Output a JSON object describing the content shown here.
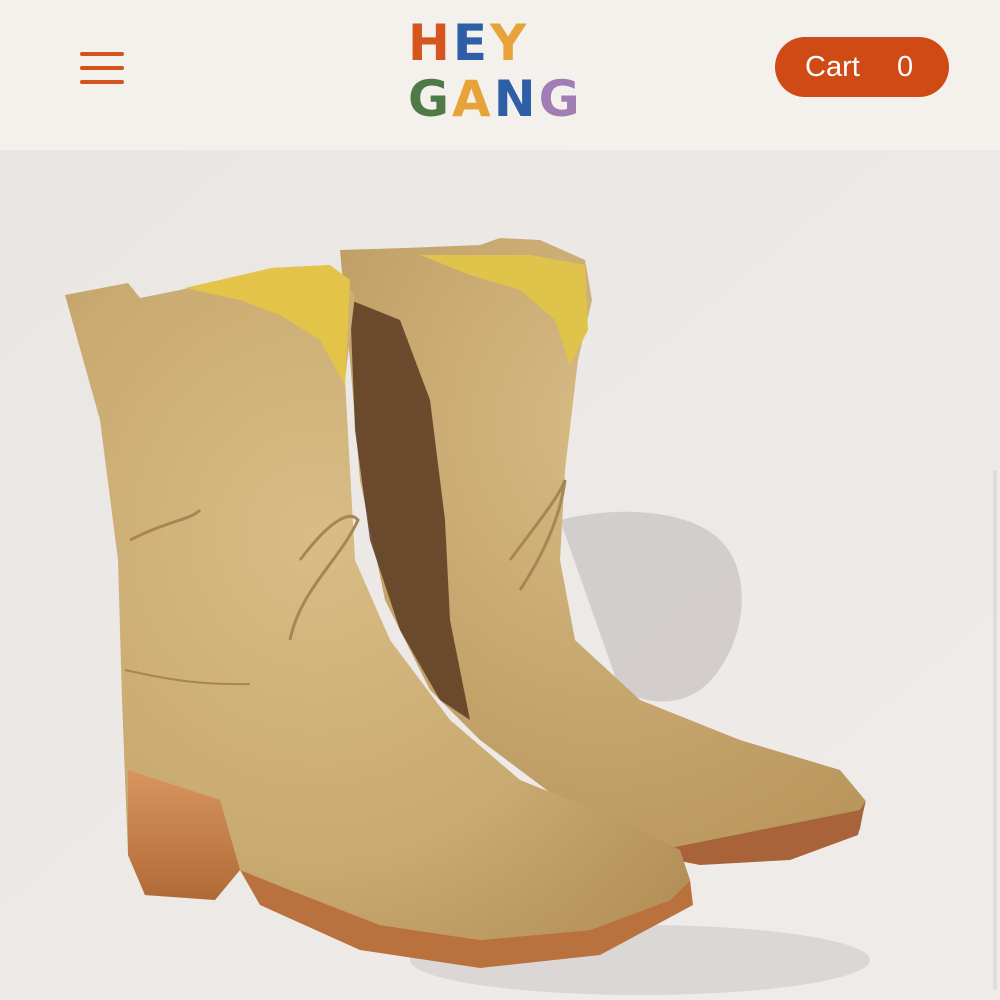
{
  "header": {
    "menu_icon": "hamburger-menu-icon",
    "logo": {
      "line1": [
        {
          "char": "H",
          "color": "#d5551f"
        },
        {
          "char": "E",
          "color": "#2e5fa6"
        },
        {
          "char": "Y",
          "color": "#e8a23a"
        }
      ],
      "line2": [
        {
          "char": "G",
          "color": "#4f7a48"
        },
        {
          "char": "A",
          "color": "#e8a23a"
        },
        {
          "char": "N",
          "color": "#2e5fa6"
        },
        {
          "char": "G",
          "color": "#a07db4"
        }
      ]
    },
    "cart": {
      "label": "Cart",
      "count": "0",
      "color": "#cf4a15"
    },
    "accent_color": "#d2541c"
  },
  "hero": {
    "image": "tan-suede-western-boots-photo"
  }
}
